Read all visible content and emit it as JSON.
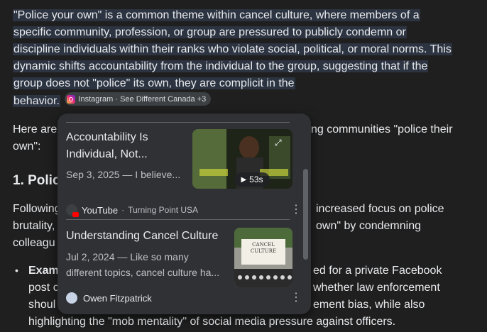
{
  "para1": {
    "line1": "\"Police your own\" is a common theme within cancel culture, where members of a",
    "line2": "specific community, profession, or group are pressured to publicly condemn or",
    "line3": "discipline individuals within their ranks who violate social, political, or moral norms. This",
    "line4": "dynamic shifts accountability from the individual to the group, suggesting that if the",
    "line5": "group does not \"police\" its own, they are complicit in the",
    "line6": "behavior."
  },
  "source_chip": {
    "label": "Instagram · See Different Canada +3",
    "icon": "instagram-icon"
  },
  "para2": {
    "left1": "Here are",
    "right1": "ng communities \"police their",
    "line2": "own\":"
  },
  "heading": {
    "text": "1. Polic"
  },
  "para3": {
    "left1": "Following",
    "right1": "increased focus on police",
    "left2": "brutality,",
    "right2": "own\" by condemning",
    "left3": "colleagu"
  },
  "bullet": {
    "bold": "Exam",
    "right1": "ed for a private Facebook",
    "left2": "post c",
    "right2": "whether law enforcement",
    "left3": "shoul",
    "right3": "ement bias, while also",
    "line4": "highlighting the \"mob mentality\" of social media pressure against officers."
  },
  "popup": {
    "cards": [
      {
        "title_line1": "Accountability Is",
        "title_line2": "Individual, Not...",
        "meta": "Sep 3, 2025 — I believe...",
        "duration": "53s",
        "source": "YouTube",
        "source_sub": "Turning Point USA",
        "menu_icon": "more-vert-icon"
      },
      {
        "title": "Understanding Cancel Culture",
        "meta_line1": "Jul 2, 2024 — Like so many",
        "meta_line2": "different topics, cancel culture ha...",
        "thumb_text": "CANCEL CULTURE",
        "source": "Owen Fitzpatrick",
        "menu_icon": "more-vert-icon"
      }
    ]
  },
  "colors": {
    "background": "#1f1f1f",
    "popup": "#303134",
    "highlight": "#2d3441"
  }
}
